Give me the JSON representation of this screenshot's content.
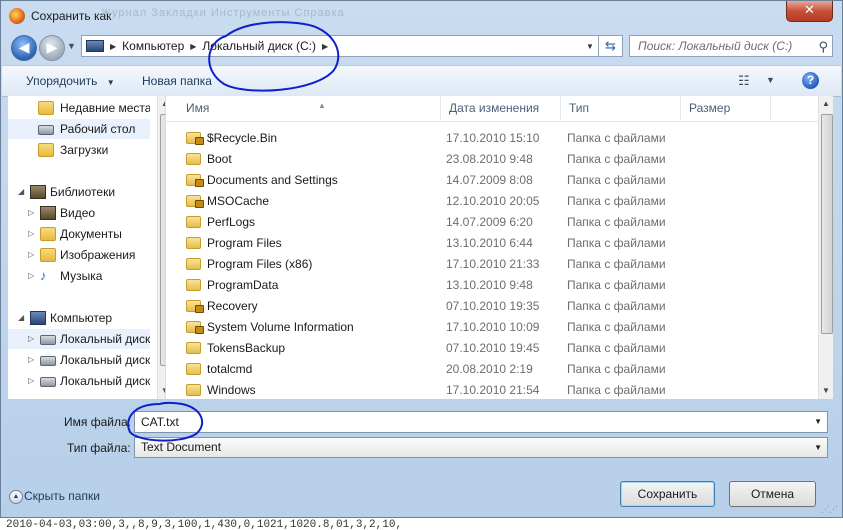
{
  "window": {
    "title": "Сохранить как",
    "menu_ghost": "Журнал   Закладки   Инструменты   Справка",
    "close_glyph": "✕"
  },
  "address": {
    "crumbs": [
      "Компьютер",
      "Локальный диск (C:)"
    ],
    "search_placeholder": "Поиск: Локальный диск (C:)"
  },
  "toolbar": {
    "organize": "Упорядочить",
    "new_folder": "Новая папка"
  },
  "nav": {
    "favorites": [
      "Недавние места",
      "Рабочий стол",
      "Загрузки"
    ],
    "libraries_label": "Библиотеки",
    "libraries": [
      "Видео",
      "Документы",
      "Изображения",
      "Музыка"
    ],
    "computer_label": "Компьютер",
    "drives": [
      "Локальный диск",
      "Локальный диск",
      "Локальный диск"
    ]
  },
  "columns": {
    "name": "Имя",
    "date": "Дата изменения",
    "type": "Тип",
    "size": "Размер"
  },
  "files": [
    {
      "name": "$Recycle.Bin",
      "date": "17.10.2010 15:10",
      "type": "Папка с файлами",
      "locked": true
    },
    {
      "name": "Boot",
      "date": "23.08.2010 9:48",
      "type": "Папка с файлами",
      "locked": false
    },
    {
      "name": "Documents and Settings",
      "date": "14.07.2009 8:08",
      "type": "Папка с файлами",
      "locked": true
    },
    {
      "name": "MSOCache",
      "date": "12.10.2010 20:05",
      "type": "Папка с файлами",
      "locked": true
    },
    {
      "name": "PerfLogs",
      "date": "14.07.2009 6:20",
      "type": "Папка с файлами",
      "locked": false
    },
    {
      "name": "Program Files",
      "date": "13.10.2010 6:44",
      "type": "Папка с файлами",
      "locked": false
    },
    {
      "name": "Program Files (x86)",
      "date": "17.10.2010 21:33",
      "type": "Папка с файлами",
      "locked": false
    },
    {
      "name": "ProgramData",
      "date": "13.10.2010 9:48",
      "type": "Папка с файлами",
      "locked": false
    },
    {
      "name": "Recovery",
      "date": "07.10.2010 19:35",
      "type": "Папка с файлами",
      "locked": true
    },
    {
      "name": "System Volume Information",
      "date": "17.10.2010 10:09",
      "type": "Папка с файлами",
      "locked": true
    },
    {
      "name": "TokensBackup",
      "date": "07.10.2010 19:45",
      "type": "Папка с файлами",
      "locked": false
    },
    {
      "name": "totalcmd",
      "date": "20.08.2010 2:19",
      "type": "Папка с файлами",
      "locked": false
    },
    {
      "name": "Windows",
      "date": "17.10.2010 21:54",
      "type": "Папка с файлами",
      "locked": false
    }
  ],
  "form": {
    "filename_label": "Имя файла:",
    "filename_value": "CAT.txt",
    "filetype_label": "Тип файла:",
    "filetype_value": "Text Document"
  },
  "footer": {
    "hide_folders": "Скрыть папки",
    "save": "Сохранить",
    "cancel": "Отмена"
  },
  "background_text": "2010-04-03,03:00,3,,8,9,3,100,1,430,0,1021,1020.8,01,3,2,10,"
}
